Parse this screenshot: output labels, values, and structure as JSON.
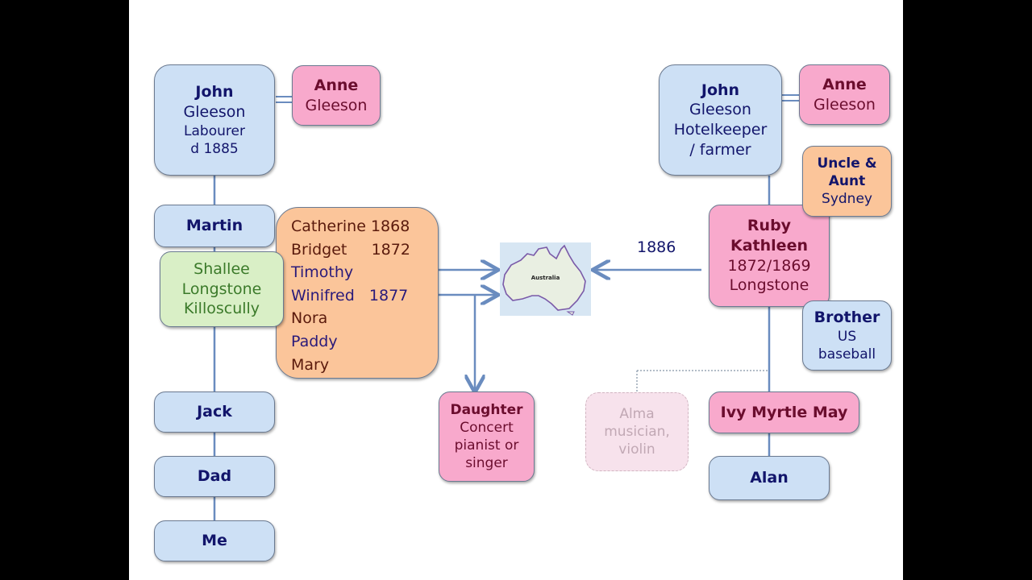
{
  "left_tree": {
    "john": {
      "first": "John",
      "lines": [
        "Gleeson",
        "Labourer",
        "d 1885"
      ]
    },
    "anne": {
      "first": "Anne",
      "last": "Gleeson"
    },
    "martin": "Martin",
    "shallee": [
      "Shallee",
      "Longstone",
      "Killoscully"
    ],
    "children": [
      {
        "name": "Catherine",
        "year": "1868",
        "emigrated": false
      },
      {
        "name": "Bridget",
        "year": "1872",
        "emigrated": false
      },
      {
        "name": "Timothy",
        "year": "",
        "emigrated": true
      },
      {
        "name": "Winifred",
        "year": "1877",
        "emigrated": true
      },
      {
        "name": "Nora",
        "year": "",
        "emigrated": false
      },
      {
        "name": "Paddy",
        "year": "",
        "emigrated": true
      },
      {
        "name": "Mary",
        "year": "",
        "emigrated": false
      }
    ],
    "daughter": {
      "title": "Daughter",
      "lines": [
        "Concert",
        "pianist or",
        "singer"
      ]
    },
    "descendants": [
      "Jack",
      "Dad",
      "Me"
    ]
  },
  "map": {
    "label": "Australia"
  },
  "arrival_year": "1886",
  "right_tree": {
    "john": {
      "first": "John",
      "lines": [
        "Gleeson",
        "Hotelkeeper",
        "/ farmer"
      ]
    },
    "anne": {
      "first": "Anne",
      "last": "Gleeson"
    },
    "uncle_aunt": {
      "title1": "Uncle &",
      "title2": "Aunt",
      "place": "Sydney"
    },
    "ruby": {
      "first": "Ruby",
      "second": "Kathleen",
      "years": "1872/1869",
      "place": "Longstone"
    },
    "brother": {
      "title": "Brother",
      "lines": [
        "US",
        "baseball"
      ]
    },
    "alma": [
      "Alma",
      "musician,",
      "violin"
    ],
    "ivy": "Ivy Myrtle May",
    "alan": "Alan"
  },
  "colors": {
    "male_box": "#cde0f5",
    "female_box": "#f8a9cc",
    "siblings_box": "#fbc59a",
    "place_box": "#d9efc6",
    "connector": "#6a8cbf"
  }
}
